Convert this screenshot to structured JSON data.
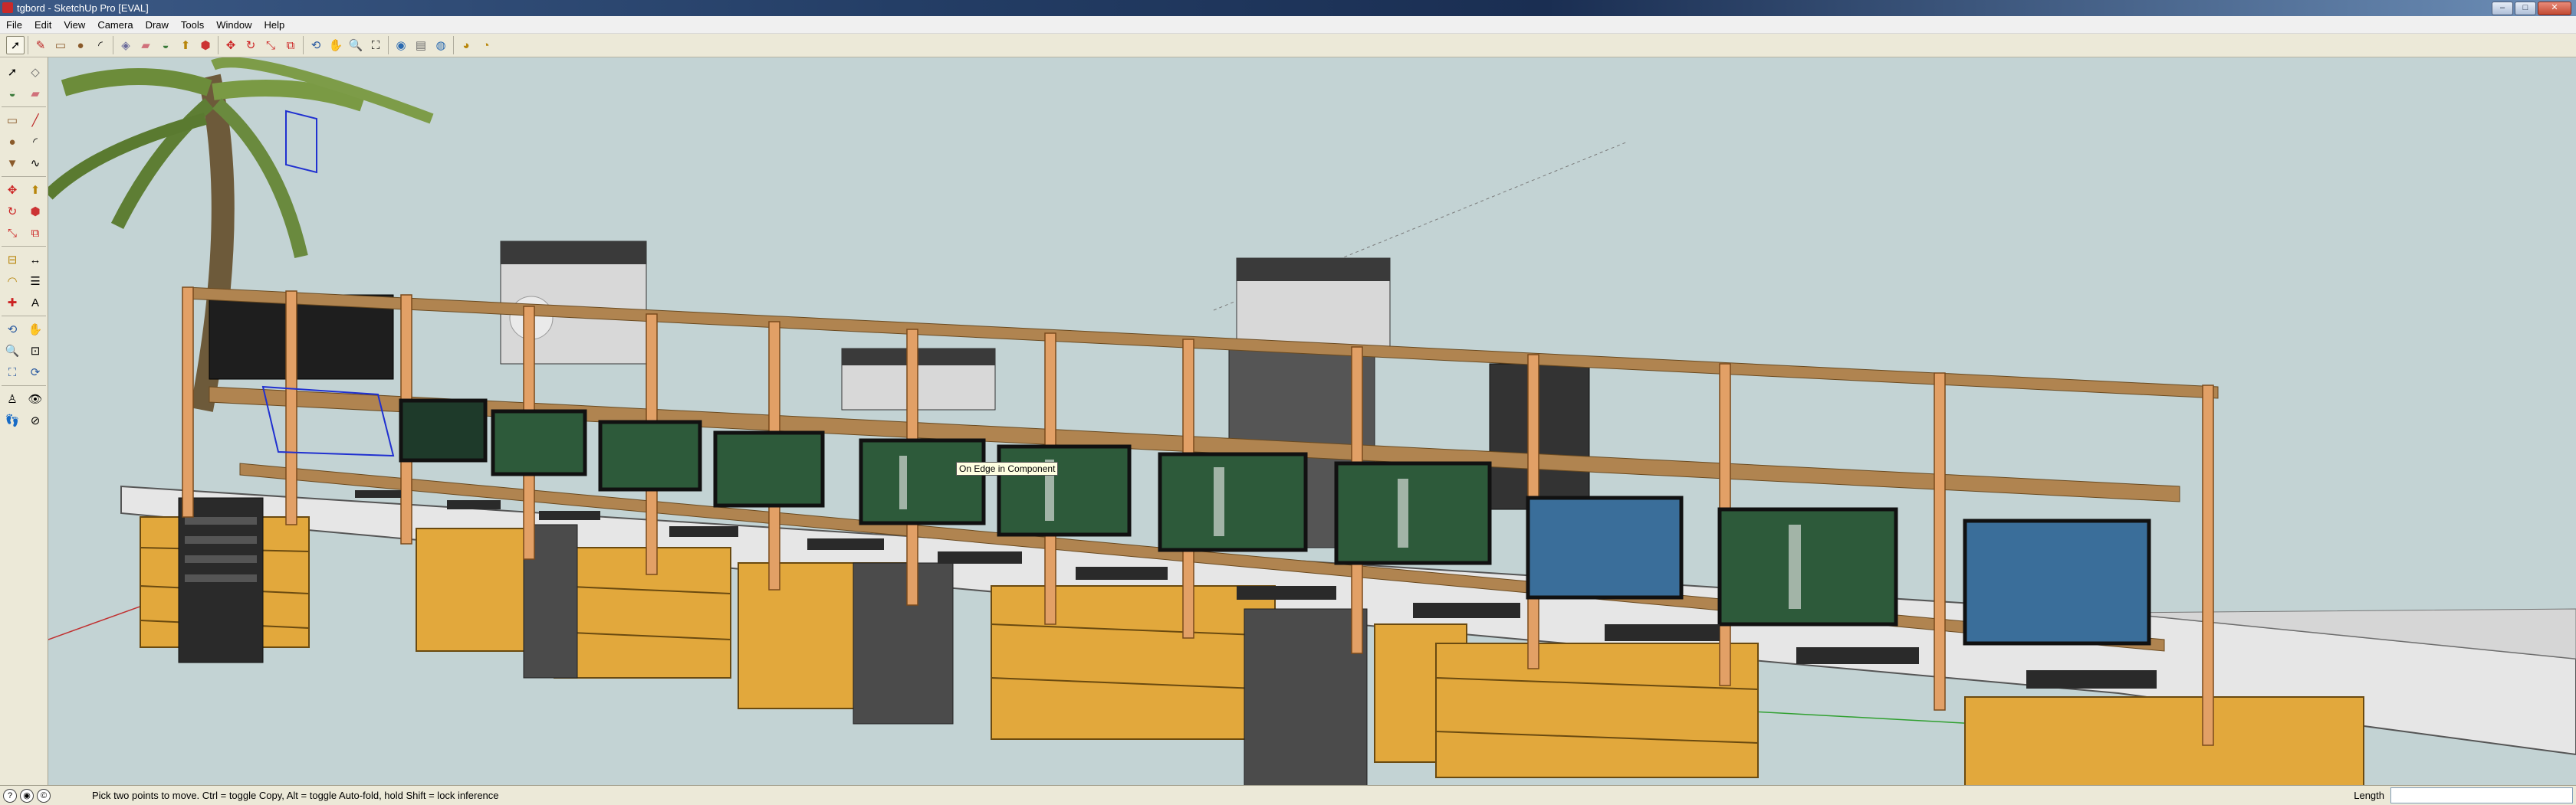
{
  "window": {
    "title": "tgbord - SketchUp Pro [EVAL]",
    "controls": {
      "minimize": "–",
      "maximize": "□",
      "close": "✕"
    }
  },
  "menu": [
    "File",
    "Edit",
    "View",
    "Camera",
    "Draw",
    "Tools",
    "Window",
    "Help"
  ],
  "toolbar": {
    "tools": [
      "select-icon",
      "pencil-icon",
      "rectangle-icon",
      "circle-icon",
      "arc-icon",
      "component-icon",
      "eraser-icon",
      "paint-bucket-icon",
      "push-pull-icon",
      "follow-me-icon",
      "move-icon",
      "rotate-icon",
      "scale-icon",
      "offset-icon",
      "orbit-icon",
      "pan-icon",
      "zoom-icon",
      "zoom-extents-icon",
      "get-models-icon",
      "share-model-icon",
      "component-library-icon",
      "google-earth-icon",
      "preview-icon"
    ]
  },
  "palette": {
    "tools": [
      "select-icon",
      "eraser-icon",
      "paint-bucket-icon",
      "erase-icon",
      "rectangle-icon",
      "line-icon",
      "circle-icon",
      "arc-icon",
      "polygon-icon",
      "freehand-icon",
      "move-icon",
      "push-pull-icon",
      "rotate-icon",
      "follow-me-icon",
      "scale-icon",
      "offset-icon",
      "tape-measure-icon",
      "dimension-icon",
      "protractor-icon",
      "text-icon",
      "axes-icon",
      "3d-text-icon",
      "orbit-icon",
      "pan-icon",
      "zoom-icon",
      "zoom-window-icon",
      "zoom-extents-icon",
      "previous-view-icon",
      "position-camera-icon",
      "look-around-icon",
      "walk-icon",
      "section-plane-icon"
    ]
  },
  "viewport": {
    "tooltip": "On Edge in Component",
    "colors": {
      "background": "#c3d3d4",
      "shelf_wood": "#e2a066",
      "shelf_board": "#b08450",
      "pallet_wood": "#e2a83c",
      "tabletop": "#e6e6e6",
      "speaker": "#2a2a2a",
      "screen_water": "#2d5a3a"
    }
  },
  "status": {
    "icons": [
      "help-icon",
      "geo-location-icon",
      "credits-icon"
    ],
    "text": "Pick two points to move.  Ctrl = toggle Copy, Alt = toggle Auto-fold, hold Shift = lock inference",
    "measurement_label": "Length",
    "measurement_value": ""
  }
}
